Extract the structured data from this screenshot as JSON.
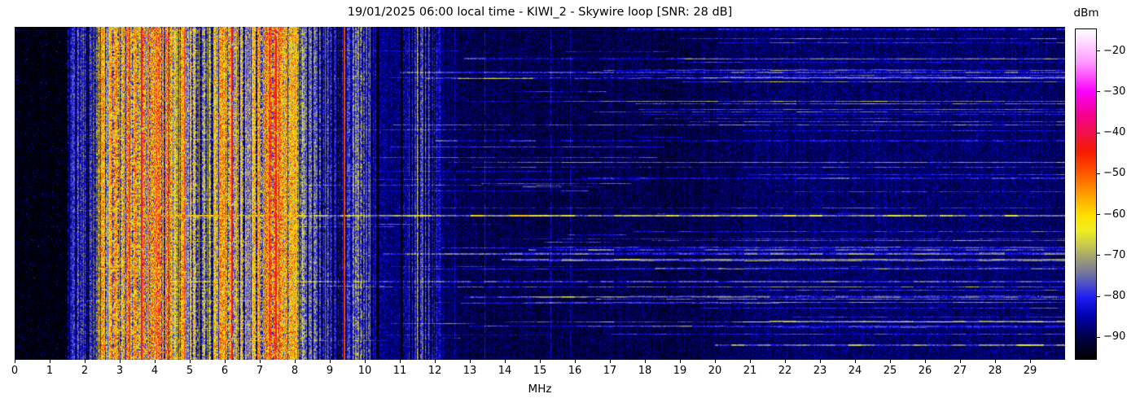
{
  "figure": {
    "title": "19/01/2025 06:00 local time - KIWI_2 - Skywire loop [SNR: 28 dB]",
    "xlabel": "MHz",
    "colorbar_label": "dBm"
  },
  "chart_data": {
    "type": "heatmap",
    "subtype": "radio-spectrogram-waterfall",
    "title": "19/01/2025 06:00 local time - KIWI_2 - Skywire loop [SNR: 28 dB]",
    "xlabel": "MHz",
    "x_range_mhz": [
      0,
      30
    ],
    "x_ticks": [
      0,
      1,
      2,
      3,
      4,
      5,
      6,
      7,
      8,
      9,
      10,
      11,
      12,
      13,
      14,
      15,
      16,
      17,
      18,
      19,
      20,
      21,
      22,
      23,
      24,
      25,
      26,
      27,
      28,
      29
    ],
    "y_ticks": [],
    "colorbar": {
      "label": "dBm",
      "tick_values": [
        -20,
        -30,
        -40,
        -50,
        -60,
        -70,
        -80,
        -90
      ],
      "tick_labels": [
        "−20",
        "−30",
        "−40",
        "−50",
        "−60",
        "−70",
        "−80",
        "−90"
      ],
      "vmax": -14.5,
      "vmin": -95.5
    },
    "colormap_stops": [
      [
        0.0,
        "#ffffff"
      ],
      [
        0.04,
        "#ffd9ff"
      ],
      [
        0.1,
        "#ff9aff"
      ],
      [
        0.19,
        "#fa00fa"
      ],
      [
        0.26,
        "#f5008f"
      ],
      [
        0.31,
        "#f01050"
      ],
      [
        0.37,
        "#f51a00"
      ],
      [
        0.435,
        "#ff5500"
      ],
      [
        0.5,
        "#ff9e00"
      ],
      [
        0.565,
        "#ffdf00"
      ],
      [
        0.61,
        "#eeee22"
      ],
      [
        0.655,
        "#c8c84e"
      ],
      [
        0.695,
        "#9e9e72"
      ],
      [
        0.735,
        "#7a7a9a"
      ],
      [
        0.78,
        "#4646d0"
      ],
      [
        0.815,
        "#1c1cf2"
      ],
      [
        0.87,
        "#0000ad"
      ],
      [
        0.935,
        "#000047"
      ],
      [
        1.0,
        "#000000"
      ]
    ],
    "spectrum_profile_mhz_dbm": [
      [
        0,
        -95
      ],
      [
        1.5,
        -95
      ],
      [
        1.58,
        -81
      ],
      [
        1.9,
        -79
      ],
      [
        2.2,
        -80
      ],
      [
        2.35,
        -73
      ],
      [
        2.42,
        -62
      ],
      [
        2.55,
        -61
      ],
      [
        2.65,
        -68
      ],
      [
        2.8,
        -59
      ],
      [
        3.0,
        -58
      ],
      [
        3.2,
        -55
      ],
      [
        3.45,
        -56
      ],
      [
        3.6,
        -54
      ],
      [
        3.8,
        -55
      ],
      [
        4.0,
        -55
      ],
      [
        4.2,
        -57
      ],
      [
        4.4,
        -60
      ],
      [
        4.6,
        -67
      ],
      [
        4.85,
        -64
      ],
      [
        5.05,
        -65
      ],
      [
        5.2,
        -67
      ],
      [
        5.35,
        -73
      ],
      [
        5.6,
        -71
      ],
      [
        5.8,
        -63
      ],
      [
        6.0,
        -60
      ],
      [
        6.25,
        -61
      ],
      [
        6.4,
        -67
      ],
      [
        6.65,
        -65
      ],
      [
        6.85,
        -64
      ],
      [
        7.0,
        -58
      ],
      [
        7.2,
        -54
      ],
      [
        7.45,
        -55
      ],
      [
        7.6,
        -58
      ],
      [
        7.8,
        -60
      ],
      [
        8.0,
        -63
      ],
      [
        8.15,
        -72
      ],
      [
        8.35,
        -77
      ],
      [
        8.6,
        -78
      ],
      [
        9.0,
        -82
      ],
      [
        9.3,
        -84
      ],
      [
        9.55,
        -80
      ],
      [
        9.8,
        -77
      ],
      [
        10.05,
        -79
      ],
      [
        10.3,
        -86
      ],
      [
        10.7,
        -88
      ],
      [
        11.0,
        -87
      ],
      [
        11.35,
        -83
      ],
      [
        11.6,
        -80
      ],
      [
        11.95,
        -83
      ],
      [
        12.3,
        -89
      ],
      [
        13,
        -90
      ],
      [
        15,
        -90.5
      ],
      [
        17,
        -90.5
      ],
      [
        19,
        -90.5
      ],
      [
        20.5,
        -89.5
      ],
      [
        21.5,
        -88.5
      ],
      [
        24,
        -88.5
      ],
      [
        26,
        -88.5
      ],
      [
        28.5,
        -88.5
      ],
      [
        30,
        -89
      ]
    ],
    "carriers": [
      {
        "mhz": 1.51,
        "dbm": -81,
        "cont": 0.45,
        "w": 1
      },
      {
        "mhz": 3.28,
        "dbm": -44,
        "cont": 0.92,
        "w": 1
      },
      {
        "mhz": 3.6,
        "dbm": -42,
        "cont": 0.95,
        "w": 2
      },
      {
        "mhz": 4.84,
        "dbm": -46,
        "cont": 0.85,
        "w": 1
      },
      {
        "mhz": 6.18,
        "dbm": -43,
        "cont": 0.95,
        "w": 2
      },
      {
        "mhz": 7.28,
        "dbm": -44,
        "cont": 0.9,
        "w": 1
      },
      {
        "mhz": 7.44,
        "dbm": -43,
        "cont": 0.92,
        "w": 2
      },
      {
        "mhz": 8.2,
        "dbm": -66,
        "cont": 0.45,
        "w": 1
      },
      {
        "mhz": 8.55,
        "dbm": -70,
        "cont": 0.4,
        "w": 1
      },
      {
        "mhz": 8.85,
        "dbm": -73,
        "cont": 0.8,
        "w": 1
      },
      {
        "mhz": 9.4,
        "dbm": -48,
        "cont": 1.0,
        "w": 2
      },
      {
        "mhz": 9.65,
        "dbm": -66,
        "cont": 0.5,
        "w": 1
      },
      {
        "mhz": 9.9,
        "dbm": -70,
        "cont": 0.45,
        "w": 1
      },
      {
        "mhz": 10.02,
        "dbm": -77,
        "cont": 0.8,
        "w": 1
      },
      {
        "mhz": 10.15,
        "dbm": -73,
        "cont": 0.85,
        "w": 1
      },
      {
        "mhz": 11.48,
        "dbm": -68,
        "cont": 0.9,
        "w": 1
      },
      {
        "mhz": 11.66,
        "dbm": -78,
        "cont": 0.7,
        "w": 1
      },
      {
        "mhz": 11.82,
        "dbm": -76,
        "cont": 0.9,
        "w": 1
      },
      {
        "mhz": 12.56,
        "dbm": -84,
        "cont": 0.8,
        "w": 1
      },
      {
        "mhz": 13.42,
        "dbm": -82,
        "cont": 0.8,
        "w": 1
      },
      {
        "mhz": 15.3,
        "dbm": -82,
        "cont": 0.7,
        "w": 1
      },
      {
        "mhz": 15.86,
        "dbm": -83,
        "cont": 0.6,
        "w": 1
      }
    ],
    "bursts": {
      "notable": [
        {
          "time_frac": 0.567,
          "from_mhz": 3.6,
          "to_mhz": 30,
          "boost": 19,
          "bright_segments": [
            [
              13.1,
              14.7
            ],
            [
              24.8,
              25.6
            ]
          ]
        },
        {
          "time_frac": 0.765,
          "from_mhz": 4.0,
          "to_mhz": 30,
          "boost": 10
        },
        {
          "time_frac": 0.135,
          "from_mhz": 11.0,
          "to_mhz": 30,
          "boost": 10
        },
        {
          "time_frac": 0.955,
          "from_mhz": 20.0,
          "to_mhz": 30,
          "boost": 14,
          "bright_segments": [
            [
              28.6,
              29.4
            ]
          ]
        }
      ],
      "right_count": 60,
      "mid_count": 45,
      "seed": 20250119
    }
  }
}
